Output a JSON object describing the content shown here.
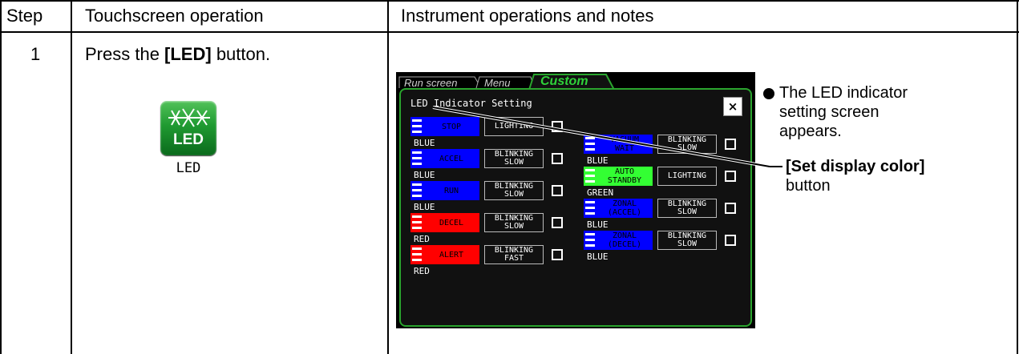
{
  "table": {
    "headers": {
      "step": "Step",
      "touch": "Touchscreen operation",
      "instrument": "Instrument operations and notes"
    },
    "row": {
      "step": "1",
      "touch_prefix": "Press the ",
      "touch_bold": "[LED]",
      "touch_suffix": " button.",
      "icon_label": "LED",
      "icon_caption": "LED"
    }
  },
  "screen": {
    "tabs": [
      "Run screen",
      "Menu",
      "Custom"
    ],
    "title": "LED Indicator Setting",
    "close_symbol": "×",
    "left_items": [
      {
        "label": "STOP",
        "mode": "LIGHTING",
        "color_name": "BLUE",
        "color": "#0000ff"
      },
      {
        "label": "ACCEL",
        "mode": "BLINKING\nSLOW",
        "color_name": "BLUE",
        "color": "#0000ff"
      },
      {
        "label": "RUN",
        "mode": "BLINKING\nSLOW",
        "color_name": "BLUE",
        "color": "#0000ff"
      },
      {
        "label": "DECEL",
        "mode": "BLINKING\nSLOW",
        "color_name": "RED",
        "color": "#ff0000"
      },
      {
        "label": "ALERT",
        "mode": "BLINKING\nFAST",
        "color_name": "RED",
        "color": "#ff0000"
      }
    ],
    "right_items": [
      {
        "label": "VACUUM\nWAIT",
        "mode": "BLINKING\nSLOW",
        "color_name": "BLUE",
        "color": "#0000ff"
      },
      {
        "label": "AUTO\nSTANDBY",
        "mode": "LIGHTING",
        "color_name": "GREEN",
        "color": "#33ff33"
      },
      {
        "label": "ZONAL\n(ACCEL)",
        "mode": "BLINKING\nSLOW",
        "color_name": "BLUE",
        "color": "#0000ff"
      },
      {
        "label": "ZONAL\n(DECEL)",
        "mode": "BLINKING\nSLOW",
        "color_name": "BLUE",
        "color": "#0000ff"
      }
    ]
  },
  "notes": {
    "bullet_text_lines": [
      "The LED indicator",
      "setting screen",
      "appears."
    ],
    "callout_bold": "[Set display color]",
    "callout_plain": "button"
  }
}
